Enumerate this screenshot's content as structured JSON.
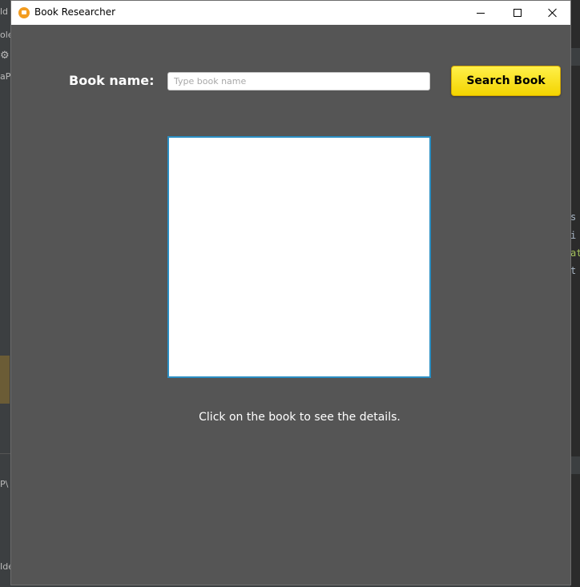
{
  "background": {
    "left_snippets": [
      "ld",
      "ole",
      "aP",
      "Ider",
      "P\\"
    ],
    "right_snippets": [
      "s",
      "i",
      "at",
      "t"
    ]
  },
  "window": {
    "title": "Book Researcher",
    "icon": "book-app-icon"
  },
  "form": {
    "label": "Book name:",
    "input_value": "",
    "input_placeholder": "Type book name",
    "button_label": "Search Book"
  },
  "hint": "Click on the book to see the details.",
  "colors": {
    "window_bg": "#555555",
    "button_accent": "#ffe500",
    "image_border": "#2b8fc4"
  }
}
